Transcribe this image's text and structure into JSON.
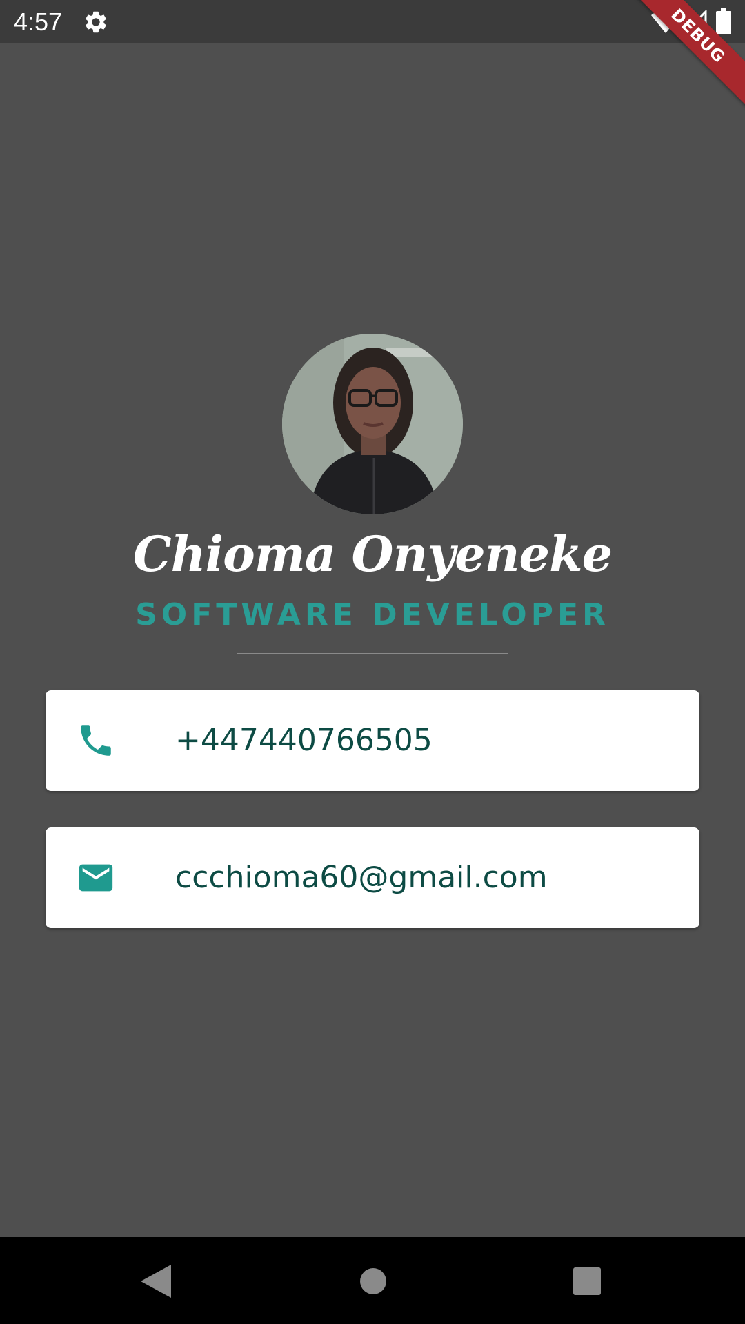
{
  "status_bar": {
    "time": "4:57",
    "icons": [
      "gear-icon",
      "wifi-icon",
      "signal-icon",
      "battery-icon"
    ]
  },
  "debug_banner": {
    "label": "DEBUG",
    "color": "#a8282d"
  },
  "profile": {
    "avatar_icon": "profile-photo",
    "name": "Chioma Onyeneke",
    "title": "SOFTWARE DEVELOPER"
  },
  "contacts": {
    "phone": {
      "icon": "phone-icon",
      "value": "+447440766505"
    },
    "email": {
      "icon": "mail-icon",
      "value": "ccchioma60@gmail.com"
    }
  },
  "nav_bar": {
    "icons": [
      "back-icon",
      "home-icon",
      "recents-icon"
    ]
  },
  "colors": {
    "background": "#4f4f4f",
    "accent": "#2a9d95",
    "contact_text": "#0d4b44",
    "card": "#ffffff"
  }
}
